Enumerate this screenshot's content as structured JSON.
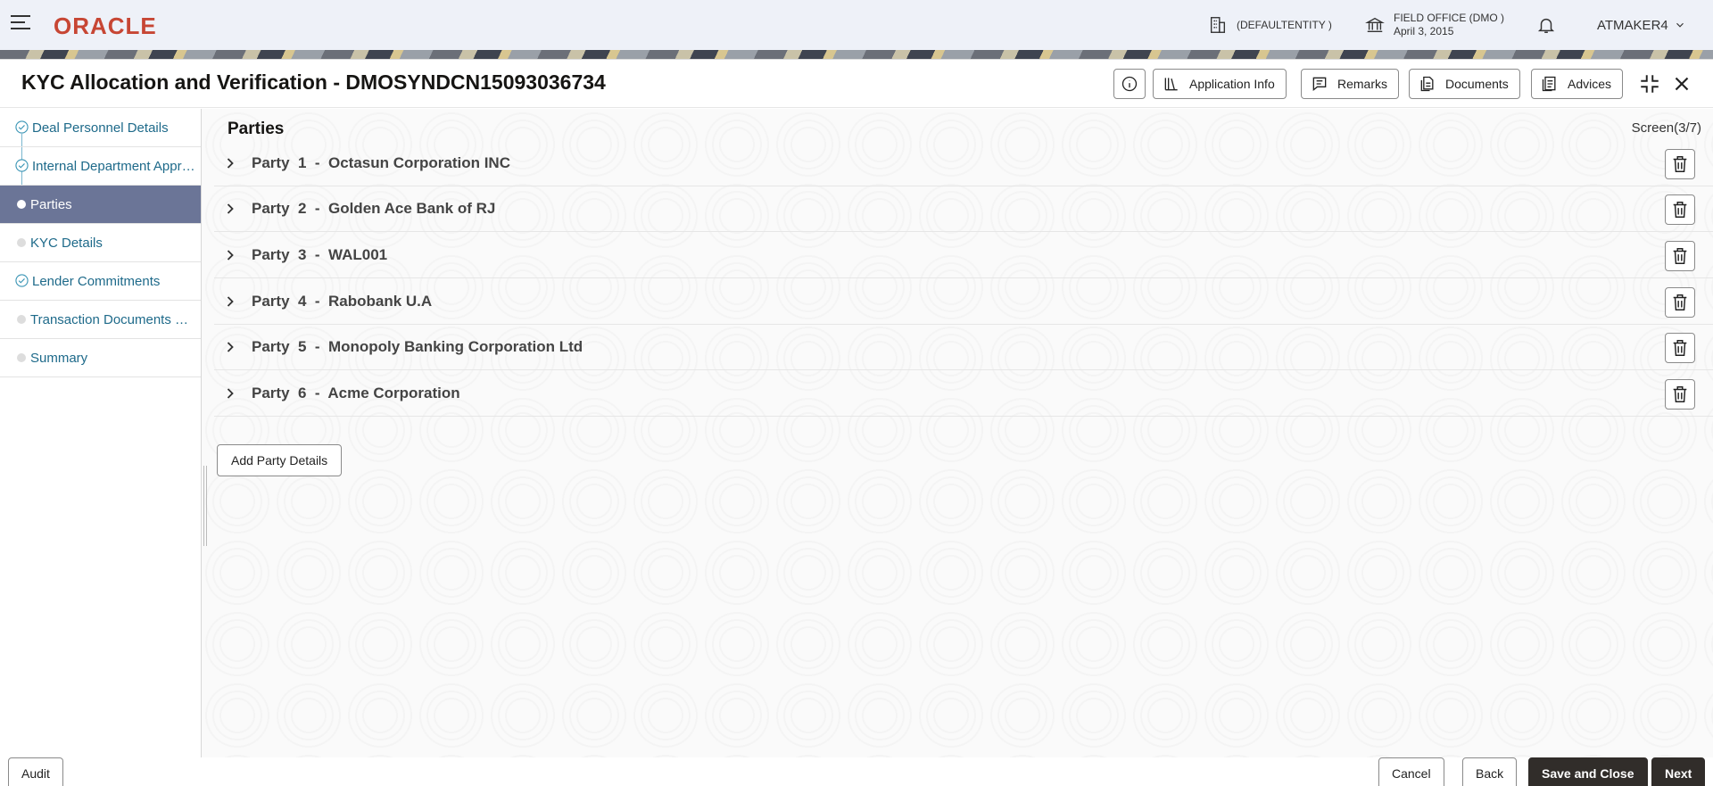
{
  "topbar": {
    "logo": "ORACLE",
    "entity": "(DEFAULTENTITY )",
    "office": "FIELD OFFICE (DMO )",
    "date": "April 3, 2015",
    "user": "ATMAKER4"
  },
  "window": {
    "title": "KYC Allocation and Verification - DMOSYNDCN15093036734",
    "buttons": {
      "application_info": "Application Info",
      "remarks": "Remarks",
      "documents": "Documents",
      "advices": "Advices"
    }
  },
  "nav": {
    "items": [
      {
        "label": "Deal Personnel Details",
        "state": "done"
      },
      {
        "label": "Internal Department Approval",
        "state": "done"
      },
      {
        "label": "Parties",
        "state": "active"
      },
      {
        "label": "KYC Details",
        "state": "pending"
      },
      {
        "label": "Lender Commitments",
        "state": "done"
      },
      {
        "label": "Transaction Documents Required",
        "state": "pending"
      },
      {
        "label": "Summary",
        "state": "pending"
      }
    ]
  },
  "content": {
    "title": "Parties",
    "screen_indicator": "Screen(3/7)",
    "parties": [
      {
        "text": "Party  1  -  Octasun Corporation INC"
      },
      {
        "text": "Party  2  -  Golden Ace Bank of RJ"
      },
      {
        "text": "Party  3  -  WAL001"
      },
      {
        "text": "Party  4  -  Rabobank U.A"
      },
      {
        "text": "Party  5  -  Monopoly Banking Corporation Ltd"
      },
      {
        "text": "Party  6  -  Acme Corporation"
      }
    ],
    "add_button": "Add Party Details"
  },
  "footer": {
    "audit": "Audit",
    "cancel": "Cancel",
    "back": "Back",
    "save_close": "Save and Close",
    "next": "Next"
  },
  "colors": {
    "brand": "#c74634",
    "nav_active": "#6b7597",
    "nav_text": "#1e6a8a",
    "dark_button": "#312d2a"
  }
}
